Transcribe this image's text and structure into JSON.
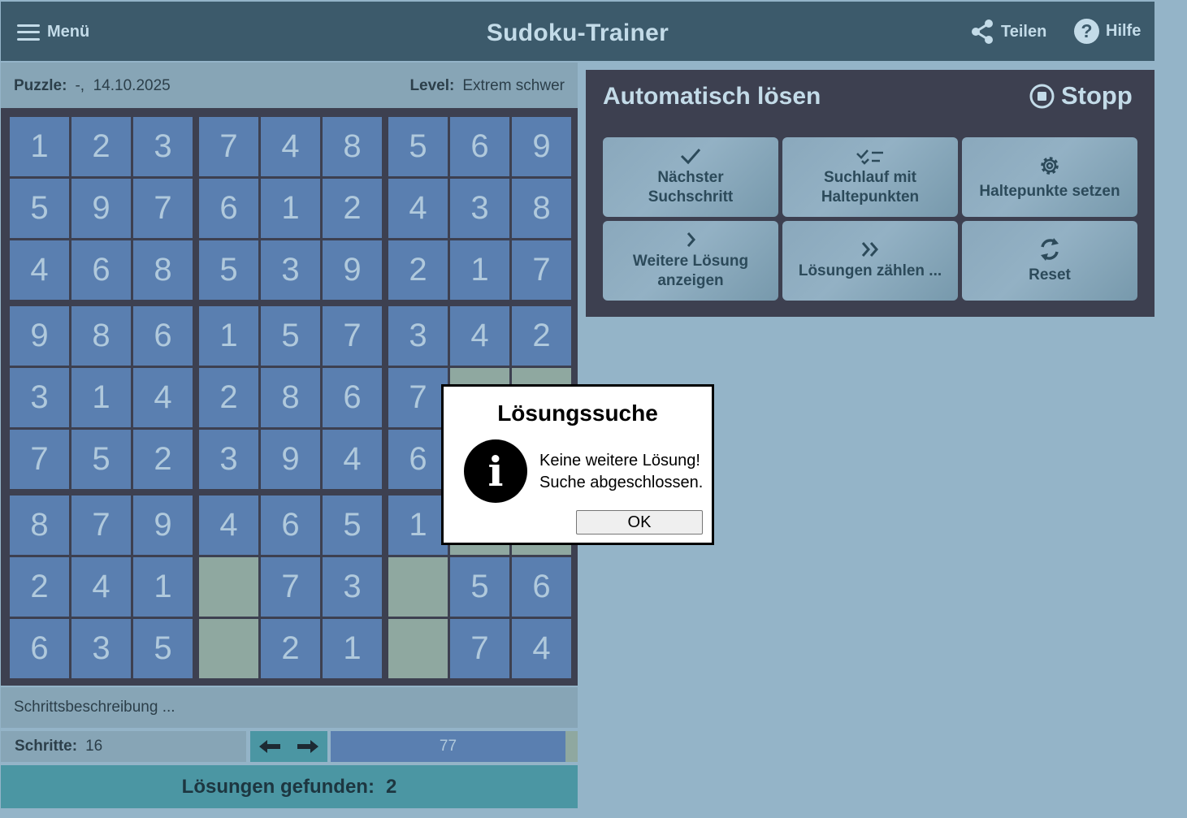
{
  "header": {
    "menu_label": "Menü",
    "title": "Sudoku-Trainer",
    "share_label": "Teilen",
    "help_label": "Hilfe"
  },
  "puzzle_info": {
    "puzzle_label": "Puzzle:",
    "puzzle_value": "-,  14.10.2025",
    "level_label": "Level:",
    "level_value": "Extrem schwer"
  },
  "board": {
    "rows": [
      [
        "1",
        "2",
        "3",
        "7",
        "4",
        "8",
        "5",
        "6",
        "9"
      ],
      [
        "5",
        "9",
        "7",
        "6",
        "1",
        "2",
        "4",
        "3",
        "8"
      ],
      [
        "4",
        "6",
        "8",
        "5",
        "3",
        "9",
        "2",
        "1",
        "7"
      ],
      [
        "9",
        "8",
        "6",
        "1",
        "5",
        "7",
        "3",
        "4",
        "2"
      ],
      [
        "3",
        "1",
        "4",
        "2",
        "8",
        "6",
        "7",
        "",
        ""
      ],
      [
        "7",
        "5",
        "2",
        "3",
        "9",
        "4",
        "6",
        "",
        ""
      ],
      [
        "8",
        "7",
        "9",
        "4",
        "6",
        "5",
        "1",
        "",
        ""
      ],
      [
        "2",
        "4",
        "1",
        "",
        "7",
        "3",
        "",
        "5",
        "6"
      ],
      [
        "6",
        "3",
        "5",
        "",
        "2",
        "1",
        "",
        "7",
        "4"
      ]
    ],
    "empty_cells": [
      [
        7,
        3
      ],
      [
        7,
        6
      ],
      [
        8,
        3
      ],
      [
        8,
        6
      ]
    ]
  },
  "step_description": "Schrittsbeschreibung ...",
  "steps": {
    "label": "Schritte:",
    "value": "16"
  },
  "progress": {
    "value": "77",
    "fraction": 0.95
  },
  "solutions": {
    "label": "Lösungen gefunden:",
    "value": "2"
  },
  "solver_panel": {
    "title": "Automatisch lösen",
    "stop_label": "Stopp",
    "buttons": [
      {
        "line1": "Nächster",
        "line2": "Suchschritt",
        "icon": "check-icon"
      },
      {
        "line1": "Suchlauf mit",
        "line2": "Haltepunkten",
        "icon": "check-list-icon"
      },
      {
        "line1": "Haltepunkte setzen",
        "line2": "",
        "icon": "gear-icon"
      },
      {
        "line1": "Weitere Lösung",
        "line2": "anzeigen",
        "icon": "chevron-right-icon"
      },
      {
        "line1": "Lösungen zählen ...",
        "line2": "",
        "icon": "double-chevron-right-icon"
      },
      {
        "line1": "Reset",
        "line2": "",
        "icon": "refresh-icon"
      }
    ]
  },
  "dialog": {
    "title": "Lösungssuche",
    "line1": "Keine weitere Lösung!",
    "line2": "Suche abgeschlossen.",
    "ok_label": "OK"
  },
  "colors": {
    "header_bg": "#3c5a6b",
    "cell_bg": "#5a7fb0",
    "empty_cell_bg": "#8fa8a0",
    "panel_bg": "#3d4050",
    "accent_teal": "#4b96a3"
  }
}
